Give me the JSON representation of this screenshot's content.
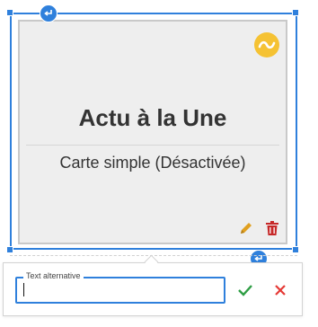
{
  "card": {
    "title": "Actu à la Une",
    "subtitle": "Carte simple (Désactivée)",
    "badge_icon": "tilde-icon",
    "badge_color": "#f5c233"
  },
  "selection": {
    "accent_color": "#2f80dc",
    "top_handle_icon": "return-arrow-icon",
    "bottom_handle_icon": "return-arrow-icon"
  },
  "actions": {
    "edit_icon": "pencil-icon",
    "delete_icon": "trash-icon",
    "edit_color": "#e0a020",
    "delete_color": "#c62828"
  },
  "alt_text": {
    "label": "Text alternative",
    "value": "",
    "save_icon": "check-icon",
    "cancel_icon": "close-icon",
    "save_color": "#2e9e44",
    "cancel_color": "#e53935"
  }
}
